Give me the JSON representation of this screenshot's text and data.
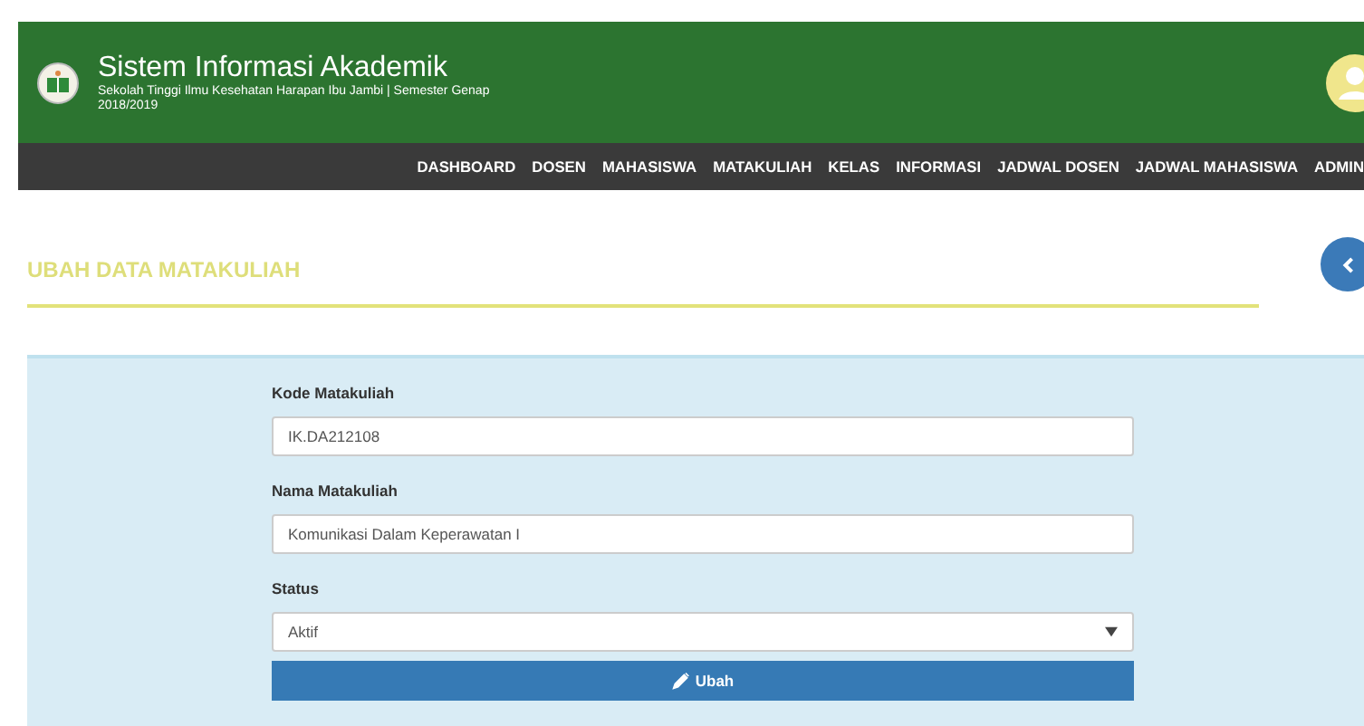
{
  "header": {
    "title": "Sistem Informasi Akademik",
    "subtitle": "Sekolah Tinggi Ilmu Kesehatan Harapan Ibu Jambi | Semester Genap",
    "year": "2018/2019"
  },
  "nav": [
    {
      "label": "DASHBOARD"
    },
    {
      "label": "DOSEN"
    },
    {
      "label": "MAHASISWA"
    },
    {
      "label": "MATAKULIAH"
    },
    {
      "label": "KELAS"
    },
    {
      "label": "INFORMASI"
    },
    {
      "label": "JADWAL DOSEN"
    },
    {
      "label": "JADWAL MAHASISWA"
    },
    {
      "label": "ADMIN"
    }
  ],
  "page_title": "UBAH DATA MATAKULIAH",
  "form": {
    "fields": [
      {
        "kind": "text",
        "label": "Kode Matakuliah",
        "value": "IK.DA212108"
      },
      {
        "kind": "text",
        "label": "Nama Matakuliah",
        "value": "Komunikasi Dalam Keperawatan I"
      },
      {
        "kind": "select",
        "label": "Status",
        "value": "Aktif"
      }
    ],
    "submit": "Ubah"
  }
}
